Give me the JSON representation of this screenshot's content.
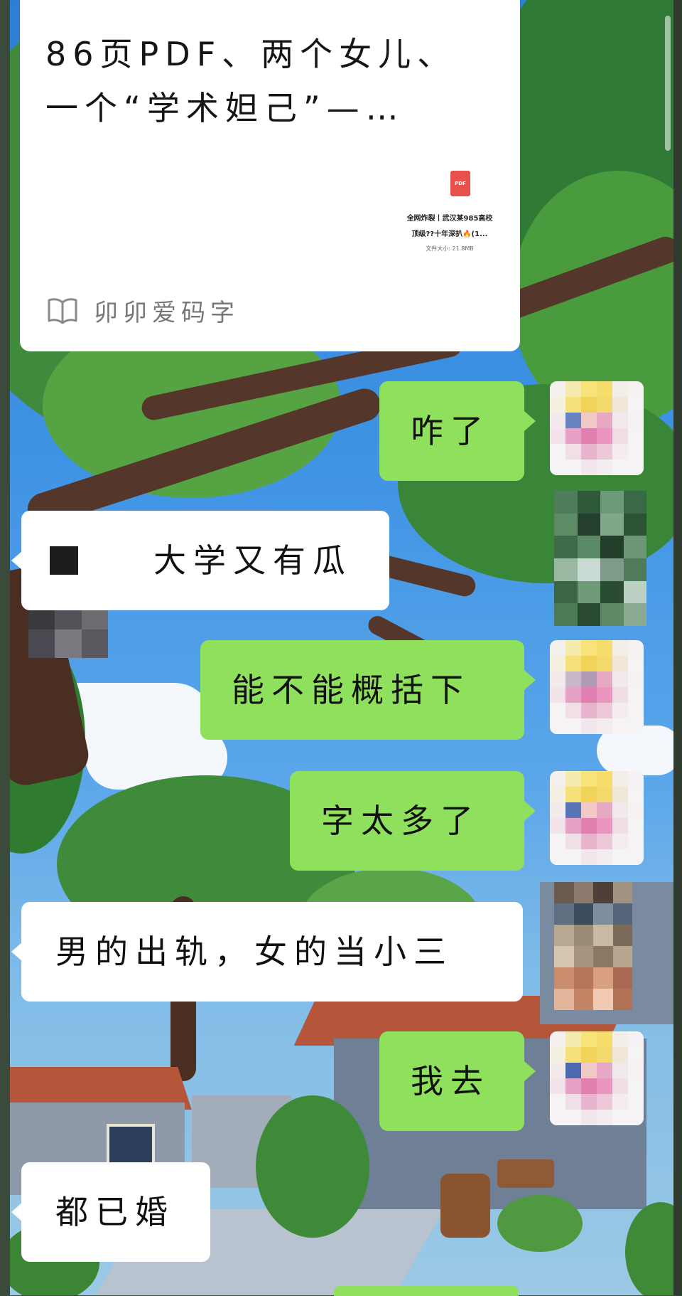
{
  "card": {
    "title": "86页PDF、两个女儿、\n一个“学术妲己”—…",
    "attachment": {
      "icon_label": "PDF",
      "line1": "全网炸裂丨武汉某985高校",
      "line2": "顶级??十年深扒🔥(1...",
      "size": "文件大小: 21.8MB"
    },
    "source_icon": "open-book-icon",
    "source_name": "卯卯爱码字"
  },
  "messages": [
    {
      "side": "out",
      "text": "咋了"
    },
    {
      "side": "in",
      "text": "　大学又有瓜",
      "prefix": "redacted-block"
    },
    {
      "side": "out",
      "text": "能不能概括下"
    },
    {
      "side": "out",
      "text": "字太多了"
    },
    {
      "side": "in",
      "text": "男的出轨，女的当小三"
    },
    {
      "side": "out",
      "text": "我去"
    },
    {
      "side": "in",
      "text": "都已婚"
    }
  ],
  "colors": {
    "incoming_bubble": "#ffffff",
    "outgoing_bubble": "#8fe05c",
    "text": "#111111",
    "source_text": "#777777"
  }
}
